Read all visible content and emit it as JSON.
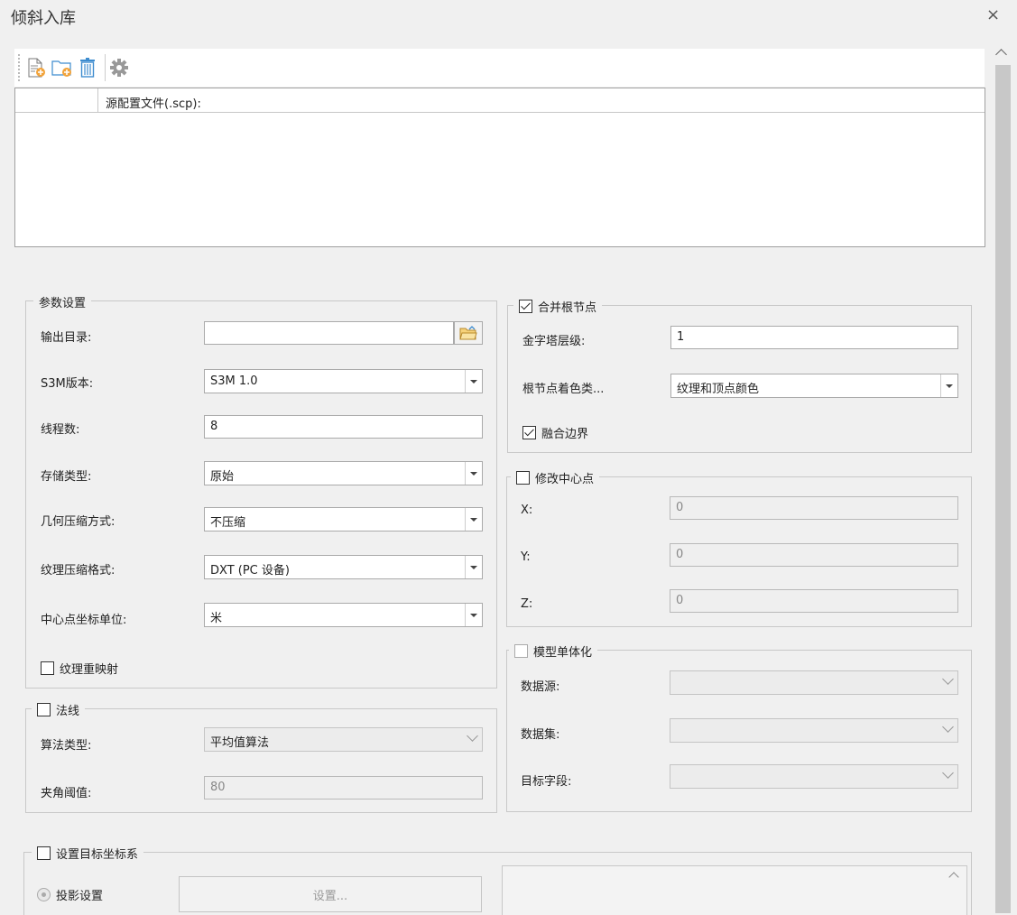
{
  "window": {
    "title": "倾斜入库",
    "close_glyph": "×"
  },
  "toolbar": {
    "icons": [
      "add-file-icon",
      "add-folder-icon",
      "delete-icon",
      "settings-icon"
    ]
  },
  "table": {
    "columns": [
      "",
      "源配置文件(.scp):"
    ]
  },
  "params": {
    "legend": "参数设置",
    "output_dir_label": "输出目录:",
    "output_dir_value": "",
    "s3m_label": "S3M版本:",
    "s3m_value": "S3M 1.0",
    "threads_label": "线程数:",
    "threads_value": "8",
    "storage_label": "存储类型:",
    "storage_value": "原始",
    "geo_compress_label": "几何压缩方式:",
    "geo_compress_value": "不压缩",
    "tex_compress_label": "纹理压缩格式:",
    "tex_compress_value": "DXT (PC 设备)",
    "center_unit_label": "中心点坐标单位:",
    "center_unit_value": "米",
    "tex_remap_label": "纹理重映射"
  },
  "normal": {
    "legend": "法线",
    "algo_label": "算法类型:",
    "algo_value": "平均值算法",
    "angle_label": "夹角阈值:",
    "angle_value": "80"
  },
  "merge": {
    "legend": "合并根节点",
    "pyramid_label": "金字塔层级:",
    "pyramid_value": "1",
    "color_label": "根节点着色类...",
    "color_value": "纹理和顶点颜色",
    "blend_label": "融合边界"
  },
  "center": {
    "legend": "修改中心点",
    "x_label": "X:",
    "x_value": "0",
    "y_label": "Y:",
    "y_value": "0",
    "z_label": "Z:",
    "z_value": "0"
  },
  "model": {
    "legend": "模型单体化",
    "datasource_label": "数据源:",
    "dataset_label": "数据集:",
    "field_label": "目标字段:"
  },
  "coord": {
    "legend": "设置目标坐标系",
    "projection_label": "投影设置",
    "setup_button": "设置..."
  }
}
